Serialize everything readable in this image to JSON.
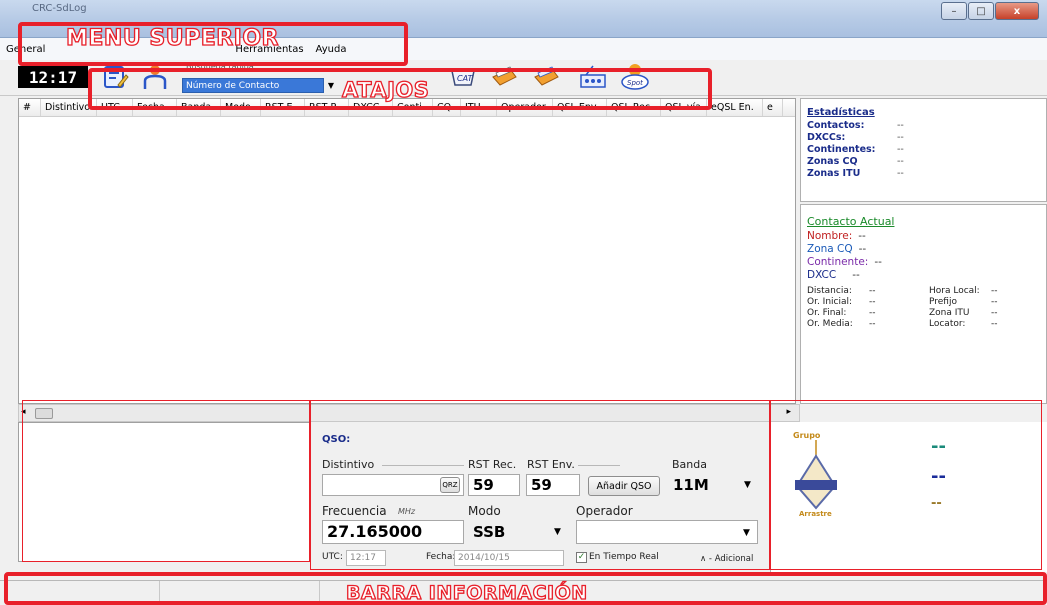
{
  "window": {
    "title": "CRC-SdLog",
    "minimize_glyph": "–",
    "maximize_glyph": "□",
    "close_glyph": "x"
  },
  "menu": {
    "items": [
      "General",
      "Herramientas",
      "Ayuda"
    ]
  },
  "toolbar": {
    "clock": "12:17",
    "search_label": "Búsqueda rápida",
    "search_value": "Número de Contacto",
    "icons": [
      "notes-icon",
      "user-icon",
      "cat-icon",
      "qsl-icon",
      "eqsl-icon",
      "radio-icon",
      "spot-icon"
    ],
    "cat_text": "CAT",
    "spot_text": "Spot"
  },
  "log_table": {
    "columns": [
      "#",
      "Distintivo",
      "UTC",
      "Fecha",
      "Banda",
      "Modo",
      "RST E.",
      "RST R.",
      "DXCC",
      "Conti.",
      "CQ",
      "ITU",
      "Operador",
      "QSL Env.",
      "QSL Rec.",
      "QSL vía",
      "eQSL En.",
      "e"
    ]
  },
  "stats": {
    "title": "Estadísticas",
    "rows": [
      {
        "label": "Contactos:",
        "value": "--"
      },
      {
        "label": "DXCCs:",
        "value": "--"
      },
      {
        "label": "Continentes:",
        "value": "--"
      },
      {
        "label": "Zonas CQ",
        "value": "--"
      },
      {
        "label": "Zonas ITU",
        "value": "--"
      }
    ]
  },
  "current": {
    "title": "Contacto Actual",
    "nombre_label": "Nombre:",
    "nombre_value": "--",
    "zonacq_label": "Zona CQ",
    "zonacq_value": "--",
    "continente_label": "Continente:",
    "continente_value": "--",
    "dxcc_label": "DXCC",
    "dxcc_value": "--",
    "details": [
      [
        "Distancia:",
        "--",
        "Hora Local:",
        "--"
      ],
      [
        "Or. Inicial:",
        "--",
        "Prefijo",
        "--"
      ],
      [
        "Or. Final:",
        "--",
        "Zona ITU",
        "--"
      ],
      [
        "Or. Media:",
        "--",
        "Locator:",
        "--"
      ]
    ]
  },
  "qso": {
    "section_label": "QSO:",
    "callsign_label": "Distintivo",
    "qrz_button": "QRZ",
    "rst_rec_label": "RST Rec.",
    "rst_rec_value": "59",
    "rst_env_label": "RST Env.",
    "rst_env_value": "59",
    "add_button": "Añadir QSO",
    "band_label": "Banda",
    "band_value": "11M",
    "freq_label": "Frecuencia",
    "freq_unit": "MHz",
    "freq_value": "27.165000",
    "mode_label": "Modo",
    "mode_value": "SSB",
    "operator_label": "Operador",
    "utc_label": "UTC:",
    "utc_value": "12:17",
    "date_label": "Fecha:",
    "date_value": "2014/10/15",
    "realtime_label": "En Tiempo Real",
    "additional_label": "∧ - Adicional"
  },
  "info_panel": {
    "logo_top": "Grupo",
    "logo_bottom": "Arrastre",
    "line1": "--",
    "line2": "--",
    "line3": "--"
  },
  "annotations": {
    "menu": "MENU SUPERIOR",
    "shortcuts": "ATAJOS",
    "info_bar": "BARRA INFORMACIÓN"
  },
  "colors": {
    "annotation": "#e8202a",
    "stats_title": "#1a2c8a",
    "current_title": "#1a8a2a",
    "search_highlight": "#3a78d8"
  }
}
